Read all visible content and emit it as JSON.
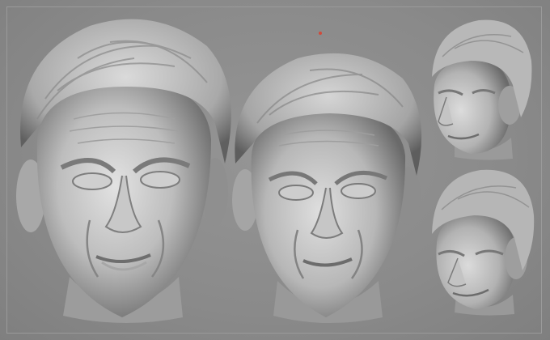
{
  "viewport": {
    "background": "#8c8c8c",
    "pivot_color": "#d04a3a"
  },
  "models": [
    {
      "view": "front",
      "icon": "sculpt-head"
    },
    {
      "view": "front-tilted",
      "icon": "sculpt-head"
    },
    {
      "view": "three-quarter-left",
      "icon": "sculpt-head"
    },
    {
      "view": "three-quarter-left-lower",
      "icon": "sculpt-head"
    }
  ]
}
